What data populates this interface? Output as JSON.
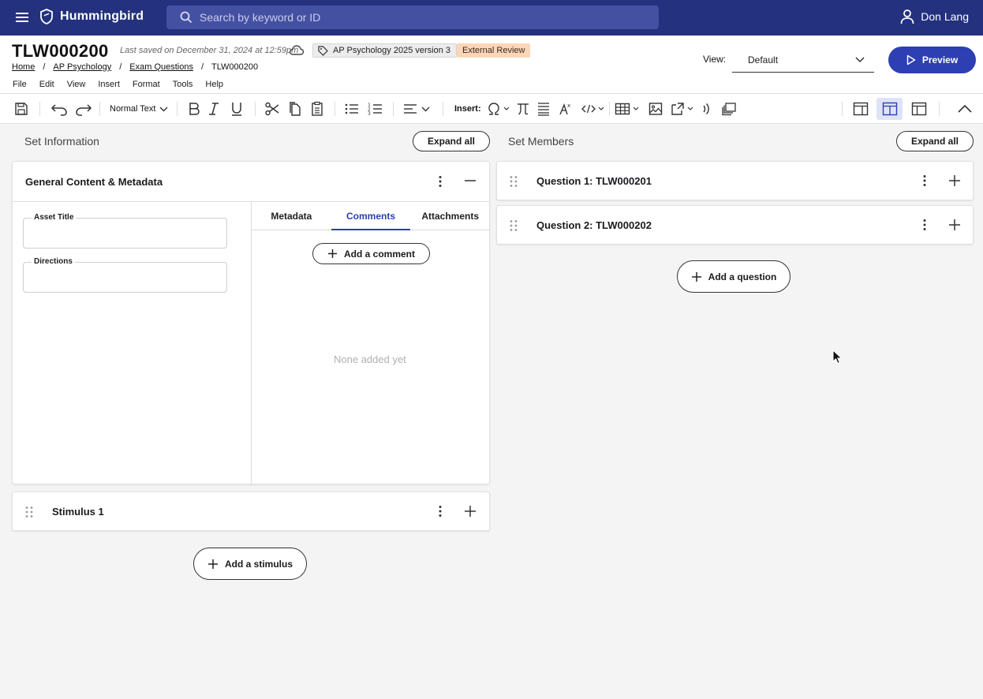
{
  "topbar": {
    "brand": "Hummingbird",
    "search_placeholder": "Search by keyword or ID",
    "user_name": "Don Lang",
    "color": "#23317f"
  },
  "header": {
    "doc_id": "TLW000200",
    "last_saved": "Last saved on December 31, 2024 at 12:59pm",
    "tag": "AP Psychology 2025 version 3",
    "status": "External Review",
    "breadcrumb": [
      "Home",
      "AP Psychology",
      "Exam Questions",
      "TLW000200"
    ],
    "menu": [
      "File",
      "Edit",
      "View",
      "Insert",
      "Format",
      "Tools",
      "Help"
    ],
    "view_label": "View:",
    "view_value": "Default",
    "preview_label": "Preview"
  },
  "toolbar": {
    "text_style": "Normal Text",
    "insert_label": "Insert:",
    "icons": [
      "save-icon",
      "undo-icon",
      "redo-icon",
      "bold-icon",
      "italic-icon",
      "underline-icon",
      "cut-icon",
      "copy-icon",
      "paste-icon",
      "bulleted-list-icon",
      "numbered-list-icon",
      "align-left-icon",
      "omega-icon",
      "pi-icon",
      "lines-icon",
      "math-icon",
      "code-icon",
      "table-icon",
      "image-icon",
      "media-icon",
      "audio-icon",
      "gallery-icon",
      "layout-left-icon",
      "layout-split-icon",
      "layout-right-icon",
      "collapse-icon"
    ]
  },
  "left": {
    "section_title": "Set Information",
    "expand_all": "Expand all",
    "card_title": "General Content & Metadata",
    "fields": [
      {
        "label": "Asset Title",
        "value": ""
      },
      {
        "label": "Directions",
        "value": ""
      }
    ],
    "tabs": [
      "Metadata",
      "Comments",
      "Attachments"
    ],
    "active_tab": "Comments",
    "add_comment": "Add a comment",
    "empty_text": "None added yet",
    "stimulus_title": "Stimulus 1",
    "add_stimulus": "Add a stimulus"
  },
  "right": {
    "section_title": "Set Members",
    "expand_all": "Expand all",
    "questions": [
      {
        "title": "Question 1: TLW000201"
      },
      {
        "title": "Question 2: TLW000202"
      }
    ],
    "add_question": "Add a question"
  },
  "colors": {
    "accent": "#2d3fb3",
    "status_bg": "#fbd6b8"
  }
}
